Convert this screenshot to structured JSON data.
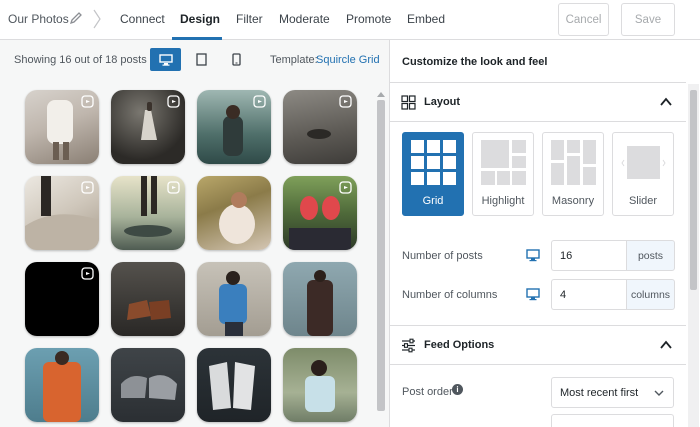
{
  "header": {
    "feed_name": "Our Photos",
    "tabs": [
      {
        "label": "Connect",
        "active": false
      },
      {
        "label": "Design",
        "active": true
      },
      {
        "label": "Filter",
        "active": false
      },
      {
        "label": "Moderate",
        "active": false
      },
      {
        "label": "Promote",
        "active": false
      },
      {
        "label": "Embed",
        "active": false
      }
    ],
    "cancel_label": "Cancel",
    "save_label": "Save"
  },
  "preview": {
    "showing_text": "Showing 16 out of 18 posts",
    "device_modes": [
      "desktop-icon",
      "tablet-icon",
      "mobile-icon"
    ],
    "active_device": "desktop",
    "template_label": "Template:",
    "template_value": "Squircle Grid"
  },
  "sidebar": {
    "title": "Customize the look and feel",
    "layout_section": {
      "title": "Layout",
      "options": [
        {
          "label": "Grid",
          "selected": true
        },
        {
          "label": "Highlight",
          "selected": false
        },
        {
          "label": "Masonry",
          "selected": false
        },
        {
          "label": "Slider",
          "selected": false
        }
      ],
      "posts_label": "Number of posts",
      "posts_value": "16",
      "posts_unit": "posts",
      "columns_label": "Number of columns",
      "columns_value": "4",
      "columns_unit": "columns"
    },
    "feed_section": {
      "title": "Feed Options",
      "post_order_label": "Post order",
      "post_order_value": "Most recent first"
    }
  },
  "colors": {
    "accent": "#2271b1",
    "border": "#dcdcde",
    "panel_bg": "#f6f7f7"
  }
}
